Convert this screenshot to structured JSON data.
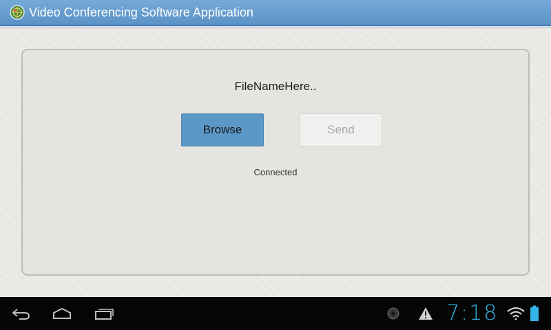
{
  "app": {
    "title": "Video Conferencing Software Application",
    "icon": "globe-icon"
  },
  "panel": {
    "file_name": "FileNameHere..",
    "browse_label": "Browse",
    "send_label": "Send",
    "status": "Connected"
  },
  "system_bar": {
    "time": "7:18",
    "clock_color": "#33b5e5",
    "nav_icons": [
      "back-icon",
      "home-icon",
      "recent-apps-icon"
    ],
    "status_icons": [
      "notification-dot-icon",
      "warning-icon",
      "wifi-icon",
      "battery-icon"
    ]
  },
  "colors": {
    "title_bar": "#6a9fd1",
    "browse_button": "#5b98c8",
    "send_button_disabled": "#f1f1ef"
  }
}
